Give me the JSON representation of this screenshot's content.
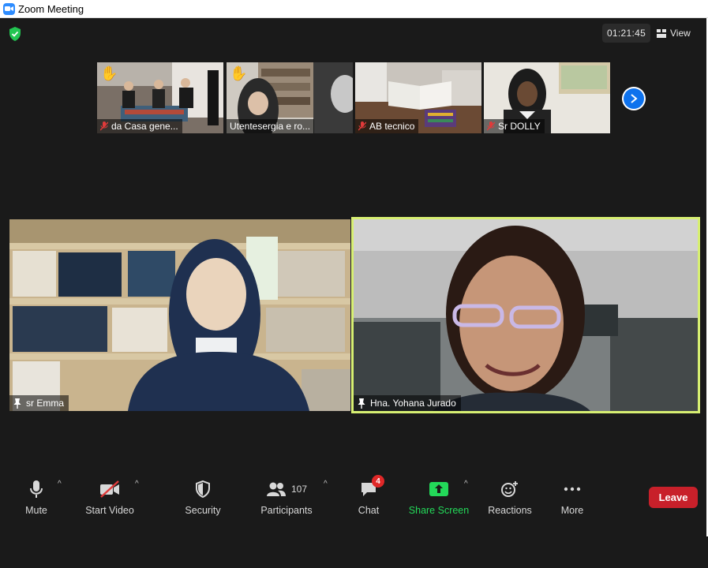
{
  "window": {
    "title": "Zoom Meeting"
  },
  "header": {
    "timer": "01:21:45",
    "view_label": "View"
  },
  "thumbnails": [
    {
      "name": "da Casa gene...",
      "muted": true,
      "hand_raised": true
    },
    {
      "name": "Utentesergia e ro...",
      "muted": false,
      "hand_raised": true
    },
    {
      "name": "AB tecnico",
      "muted": true,
      "hand_raised": false
    },
    {
      "name": "Sr DOLLY",
      "muted": true,
      "hand_raised": false
    }
  ],
  "main_tiles": [
    {
      "name": "sr Emma",
      "pinned": true,
      "active_speaker": false
    },
    {
      "name": "Hna. Yohana Jurado",
      "pinned": true,
      "active_speaker": true
    }
  ],
  "toolbar": {
    "mute_label": "Mute",
    "video_label": "Start Video",
    "security_label": "Security",
    "participants_label": "Participants",
    "participants_count": "107",
    "chat_label": "Chat",
    "chat_badge": "4",
    "share_label": "Share Screen",
    "reactions_label": "Reactions",
    "more_label": "More",
    "leave_label": "Leave"
  },
  "colors": {
    "accent_blue": "#0e72ed",
    "active_border": "#d7ef72",
    "share_green": "#23d959",
    "leave_red": "#c8202a",
    "badge_red": "#e02828"
  }
}
